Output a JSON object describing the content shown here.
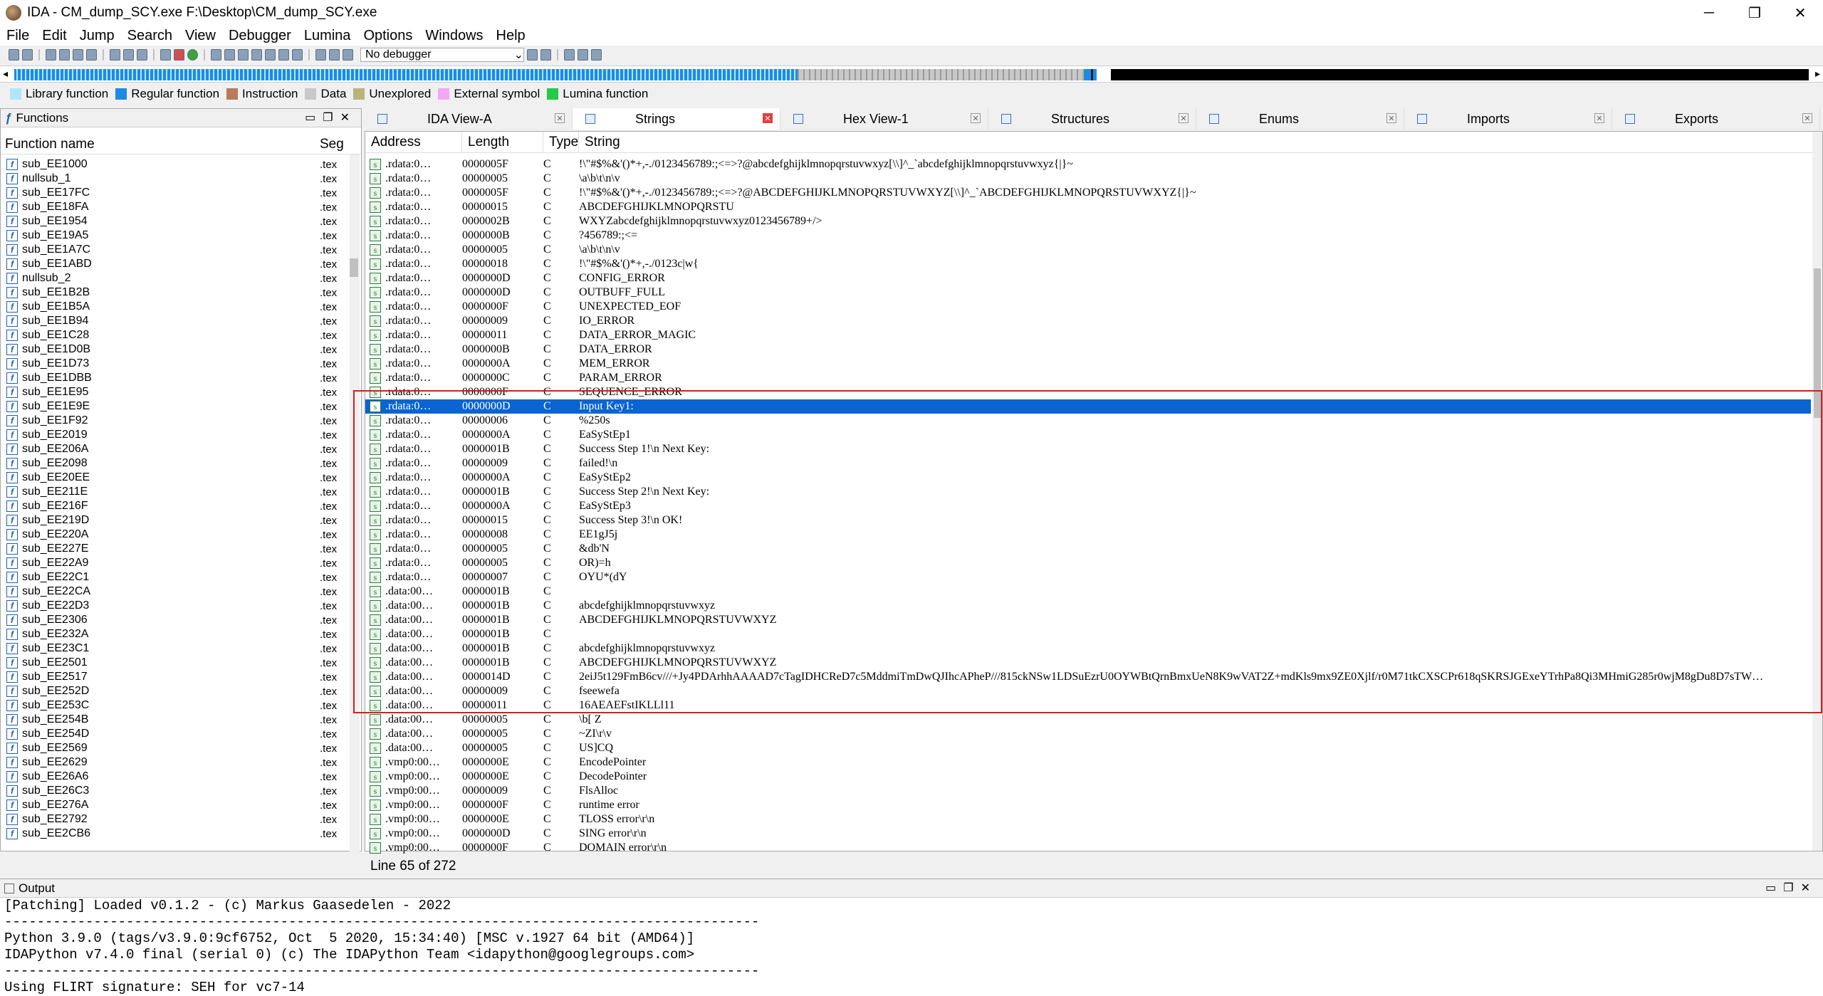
{
  "window": {
    "title": "IDA - CM_dump_SCY.exe F:\\Desktop\\CM_dump_SCY.exe",
    "min": "─",
    "max": "❐",
    "close": "✕"
  },
  "menu": [
    "File",
    "Edit",
    "Jump",
    "Search",
    "View",
    "Debugger",
    "Lumina",
    "Options",
    "Windows",
    "Help"
  ],
  "toolbar": {
    "debugger": "No debugger"
  },
  "legend": [
    {
      "label": "Library function",
      "color": "#aee8f8"
    },
    {
      "label": "Regular function",
      "color": "#1e8ae6"
    },
    {
      "label": "Instruction",
      "color": "#b97a5a"
    },
    {
      "label": "Data",
      "color": "#c8c8c8"
    },
    {
      "label": "Unexplored",
      "color": "#b8b47a"
    },
    {
      "label": "External symbol",
      "color": "#f4a6f4"
    },
    {
      "label": "Lumina function",
      "color": "#22cc44"
    }
  ],
  "functions": {
    "title": "Functions",
    "col_name": "Function name",
    "col_seg": "Seg",
    "items": [
      "sub_EE1000",
      "nullsub_1",
      "sub_EE17FC",
      "sub_EE18FA",
      "sub_EE1954",
      "sub_EE19A5",
      "sub_EE1A7C",
      "sub_EE1ABD",
      "nullsub_2",
      "sub_EE1B2B",
      "sub_EE1B5A",
      "sub_EE1B94",
      "sub_EE1C28",
      "sub_EE1D0B",
      "sub_EE1D73",
      "sub_EE1DBB",
      "sub_EE1E95",
      "sub_EE1E9E",
      "sub_EE1F92",
      "sub_EE2019",
      "sub_EE206A",
      "sub_EE2098",
      "sub_EE20EE",
      "sub_EE211E",
      "sub_EE216F",
      "sub_EE219D",
      "sub_EE220A",
      "sub_EE227E",
      "sub_EE22A9",
      "sub_EE22C1",
      "sub_EE22CA",
      "sub_EE22D3",
      "sub_EE2306",
      "sub_EE232A",
      "sub_EE23C1",
      "sub_EE2501",
      "sub_EE2517",
      "sub_EE252D",
      "sub_EE253C",
      "sub_EE254B",
      "sub_EE254D",
      "sub_EE2569",
      "sub_EE2629",
      "sub_EE26A6",
      "sub_EE26C3",
      "sub_EE276A",
      "sub_EE2792",
      "sub_EE2CB6"
    ],
    "seg": ".tex"
  },
  "tabs": [
    "IDA View-A",
    "Strings",
    "Hex View-1",
    "Structures",
    "Enums",
    "Imports",
    "Exports"
  ],
  "strings": {
    "cols": [
      "Address",
      "Length",
      "Type",
      "String"
    ],
    "rows": [
      [
        ".rdata:0…",
        "0000005F",
        "C",
        " !\\\"#$%&'()*+,-./0123456789:;<=>?@abcdefghijklmnopqrstuvwxyz[\\\\]^_`abcdefghijklmnopqrstuvwxyz{|}~"
      ],
      [
        ".rdata:0…",
        "00000005",
        "C",
        "\\a\\b\\t\\n\\v"
      ],
      [
        ".rdata:0…",
        "0000005F",
        "C",
        " !\\\"#$%&'()*+,-./0123456789:;<=>?@ABCDEFGHIJKLMNOPQRSTUVWXYZ[\\\\]^_`ABCDEFGHIJKLMNOPQRSTUVWXYZ{|}~"
      ],
      [
        ".rdata:0…",
        "00000015",
        "C",
        "ABCDEFGHIJKLMNOPQRSTU"
      ],
      [
        ".rdata:0…",
        "0000002B",
        "C",
        "WXYZabcdefghijklmnopqrstuvwxyz0123456789+/>"
      ],
      [
        ".rdata:0…",
        "0000000B",
        "C",
        "?456789:;<="
      ],
      [
        ".rdata:0…",
        "00000005",
        "C",
        "\\a\\b\\t\\n\\v"
      ],
      [
        ".rdata:0…",
        "00000018",
        "C",
        " !\\\"#$%&'()*+,-./0123c|w{"
      ],
      [
        ".rdata:0…",
        "0000000D",
        "C",
        "CONFIG_ERROR"
      ],
      [
        ".rdata:0…",
        "0000000D",
        "C",
        "OUTBUFF_FULL"
      ],
      [
        ".rdata:0…",
        "0000000F",
        "C",
        "UNEXPECTED_EOF"
      ],
      [
        ".rdata:0…",
        "00000009",
        "C",
        "IO_ERROR"
      ],
      [
        ".rdata:0…",
        "00000011",
        "C",
        "DATA_ERROR_MAGIC"
      ],
      [
        ".rdata:0…",
        "0000000B",
        "C",
        "DATA_ERROR"
      ],
      [
        ".rdata:0…",
        "0000000A",
        "C",
        "MEM_ERROR"
      ],
      [
        ".rdata:0…",
        "0000000C",
        "C",
        "PARAM_ERROR"
      ],
      [
        ".rdata:0…",
        "0000000F",
        "C",
        "SEQUENCE_ERROR"
      ],
      [
        ".rdata:0…",
        "0000000D",
        "C",
        "Input Key1:"
      ],
      [
        ".rdata:0…",
        "00000006",
        "C",
        "%250s"
      ],
      [
        ".rdata:0…",
        "0000000A",
        "C",
        "EaSyStEp1"
      ],
      [
        ".rdata:0…",
        "0000001B",
        "C",
        "Success Step 1!\\n Next Key:"
      ],
      [
        ".rdata:0…",
        "00000009",
        "C",
        "failed!\\n"
      ],
      [
        ".rdata:0…",
        "0000000A",
        "C",
        "EaSyStEp2"
      ],
      [
        ".rdata:0…",
        "0000001B",
        "C",
        "Success Step 2!\\n Next Key:"
      ],
      [
        ".rdata:0…",
        "0000000A",
        "C",
        "EaSyStEp3"
      ],
      [
        ".rdata:0…",
        "00000015",
        "C",
        "Success Step 3!\\n OK!"
      ],
      [
        ".rdata:0…",
        "00000008",
        "C",
        "EE1gJ5j"
      ],
      [
        ".rdata:0…",
        "00000005",
        "C",
        "&db'N"
      ],
      [
        ".rdata:0…",
        "00000005",
        "C",
        "OR)=h"
      ],
      [
        ".rdata:0…",
        "00000007",
        "C",
        "OYU*(dY"
      ],
      [
        ".data:00…",
        "0000001B",
        "C",
        ""
      ],
      [
        ".data:00…",
        "0000001B",
        "C",
        "abcdefghijklmnopqrstuvwxyz"
      ],
      [
        ".data:00…",
        "0000001B",
        "C",
        "ABCDEFGHIJKLMNOPQRSTUVWXYZ"
      ],
      [
        ".data:00…",
        "0000001B",
        "C",
        ""
      ],
      [
        ".data:00…",
        "0000001B",
        "C",
        "abcdefghijklmnopqrstuvwxyz"
      ],
      [
        ".data:00…",
        "0000001B",
        "C",
        "ABCDEFGHIJKLMNOPQRSTUVWXYZ"
      ],
      [
        ".data:00…",
        "0000014D",
        "C",
        "2eiJ5t129FmB6cv///+Jy4PDArhhAAAAD7cTagIDHCReD7c5MddmiTmDwQJIhcAPheP///815ckNSw1LDSuEzrU0OYWBtQrnBmxUeN8K9wVAT2Z+mdKls9mx9ZE0Xjlf/r0M71tkCXSCPr618qSKRSJGExeYTrhPa8Qi3MHmiG285r0wjM8gDu8D7sTW…"
      ],
      [
        ".data:00…",
        "00000009",
        "C",
        "fseewefa"
      ],
      [
        ".data:00…",
        "00000011",
        "C",
        "16AEAEFstIKLLl11"
      ],
      [
        ".data:00…",
        "00000005",
        "C",
        " \\b[ Z"
      ],
      [
        ".data:00…",
        "00000005",
        "C",
        "~ZI\\r\\v"
      ],
      [
        ".data:00…",
        "00000005",
        "C",
        "US]CQ"
      ],
      [
        ".vmp0:00…",
        "0000000E",
        "C",
        "EncodePointer"
      ],
      [
        ".vmp0:00…",
        "0000000E",
        "C",
        "DecodePointer"
      ],
      [
        ".vmp0:00…",
        "00000009",
        "C",
        "FlsAlloc"
      ],
      [
        ".vmp0:00…",
        "0000000F",
        "C",
        "runtime error"
      ],
      [
        ".vmp0:00…",
        "0000000E",
        "C",
        "TLOSS error\\r\\n"
      ],
      [
        ".vmp0:00…",
        "0000000D",
        "C",
        "SING error\\r\\n"
      ],
      [
        ".vmp0:00…",
        "0000000F",
        "C",
        "DOMAIN error\\r\\n"
      ]
    ],
    "selected_index": 17,
    "line_count": "Line 65 of 272"
  },
  "output": {
    "title": "Output",
    "lines": [
      "[Patching] Loaded v0.1.2 - (c) Markus Gaasedelen - 2022",
      "---------------------------------------------------------------------------------------------",
      "Python 3.9.0 (tags/v3.9.0:9cf6752, Oct  5 2020, 15:34:40) [MSC v.1927 64 bit (AMD64)]",
      "IDAPython v7.4.0 final (serial 0) (c) The IDAPython Team <idapython@googlegroups.com>",
      "---------------------------------------------------------------------------------------------",
      "Using FLIRT signature: SEH for vc7-14"
    ]
  }
}
